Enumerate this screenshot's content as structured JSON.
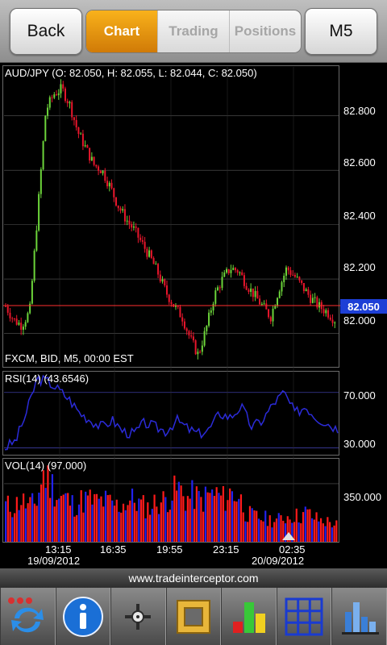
{
  "header": {
    "back_label": "Back",
    "tabs": [
      {
        "label": "Chart",
        "active": true
      },
      {
        "label": "Trading",
        "active": false
      },
      {
        "label": "Positions",
        "active": false
      }
    ],
    "timeframe_label": "M5"
  },
  "chart": {
    "info_line": "AUD/JPY (O: 82.050, H: 82.055, L: 82.044, C: 82.050)",
    "source_line": "FXCM, BID, M5, 00:00 EST",
    "price_ticks": [
      "82.800",
      "82.600",
      "82.400",
      "82.200",
      "82.000"
    ],
    "current_price": "82.050",
    "rsi_label": "RSI(14) (43.6546)",
    "rsi_ticks": [
      "70.000",
      "30.000"
    ],
    "vol_label": "VOL(14) (97.000)",
    "vol_ticks": [
      "350.000"
    ],
    "time_labels": [
      "13:15",
      "16:35",
      "19:55",
      "23:15",
      "02:35"
    ],
    "date_labels": [
      "19/09/2012",
      "20/09/2012"
    ],
    "colors": {
      "up": "#6cd43a",
      "down": "#e8162c",
      "rsi": "#2b2bd8",
      "vol_a": "#ff1a1a",
      "vol_b": "#2222ee",
      "price_line": "#ff3030",
      "grid": "#5a5a5a"
    }
  },
  "chart_data": [
    {
      "type": "line",
      "title": "AUD/JPY (O: 82.050, H: 82.055, L: 82.044, C: 82.050)",
      "xlabel": "",
      "ylabel": "",
      "ylim": [
        81.88,
        82.98
      ],
      "x": [
        "13:15",
        "16:35",
        "19:55",
        "23:15",
        "02:35"
      ],
      "series": [
        {
          "values": [
            82.1,
            82.05,
            82.03,
            82.08,
            82.45,
            82.82,
            82.88,
            82.9,
            82.84,
            82.74,
            82.68,
            82.62,
            82.6,
            82.54,
            82.47,
            82.42,
            82.38,
            82.33,
            82.28,
            82.22,
            82.15,
            82.1,
            82.06,
            81.98,
            81.92,
            82.02,
            82.14,
            82.2,
            82.24,
            82.23,
            82.18,
            82.14,
            82.1,
            82.06,
            82.16,
            82.24,
            82.21,
            82.17,
            82.13,
            82.1,
            82.08,
            82.05
          ]
        }
      ]
    },
    {
      "type": "line",
      "title": "RSI(14) (43.6546)",
      "ylim": [
        25,
        85
      ],
      "series": [
        {
          "values": [
            30,
            35,
            55,
            80,
            78,
            72,
            65,
            55,
            50,
            45,
            50,
            42,
            40,
            48,
            45,
            42,
            50,
            44,
            40,
            43,
            55,
            52,
            60,
            45,
            50,
            62,
            70,
            55,
            60,
            52,
            48,
            43.65
          ]
        }
      ]
    },
    {
      "type": "bar",
      "title": "VOL(14) (97.000)",
      "ylim": [
        0,
        500
      ],
      "values": [
        260,
        240,
        300,
        250,
        270,
        480,
        420,
        320,
        310,
        260,
        290,
        300,
        280,
        290,
        270,
        250,
        280,
        300,
        260,
        240,
        280,
        290,
        330,
        380,
        300,
        330,
        290,
        330,
        340,
        300,
        350,
        330,
        200,
        180,
        170,
        160,
        150,
        170,
        190,
        180,
        210,
        170,
        150,
        140,
        120
      ]
    }
  ],
  "footer": {
    "url": "www.tradeinterceptor.com",
    "tools": [
      {
        "icon": "refresh-icon"
      },
      {
        "icon": "info-icon"
      },
      {
        "icon": "crosshair-icon"
      },
      {
        "icon": "ruler-frame-icon"
      },
      {
        "icon": "indicators-chart-icon"
      },
      {
        "icon": "grid-icon"
      },
      {
        "icon": "chart-settings-icon"
      }
    ]
  }
}
